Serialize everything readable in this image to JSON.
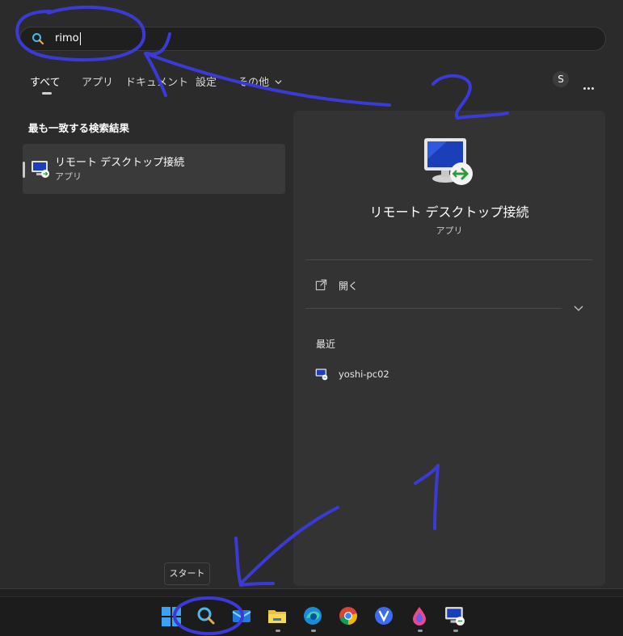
{
  "search": {
    "query": "rimo"
  },
  "tabs": [
    {
      "label": "すべて",
      "active": true
    },
    {
      "label": "アプリ"
    },
    {
      "label": "ドキュメント"
    },
    {
      "label": "設定"
    },
    {
      "label": "その他"
    }
  ],
  "user": {
    "avatar_letter": "S"
  },
  "results": {
    "section_title": "最も一致する検索結果",
    "best_match": {
      "title": "リモート デスクトップ接続",
      "subtitle": "アプリ"
    }
  },
  "detail": {
    "title": "リモート デスクトップ接続",
    "subtitle": "アプリ",
    "open_label": "開く",
    "recent_title": "最近",
    "recent_items": [
      {
        "label": "yoshi-pc02"
      }
    ]
  },
  "tooltip": {
    "label": "スタート"
  },
  "taskbar": {
    "items": [
      "start-icon",
      "search-icon",
      "mail-icon",
      "file-explorer-icon",
      "edge-icon",
      "chrome-icon",
      "vivaldi-icon",
      "paint-icon",
      "remote-desktop-icon"
    ]
  },
  "annotations": {
    "label_1": "1",
    "label_2": "2",
    "color": "#3a3ad6"
  }
}
